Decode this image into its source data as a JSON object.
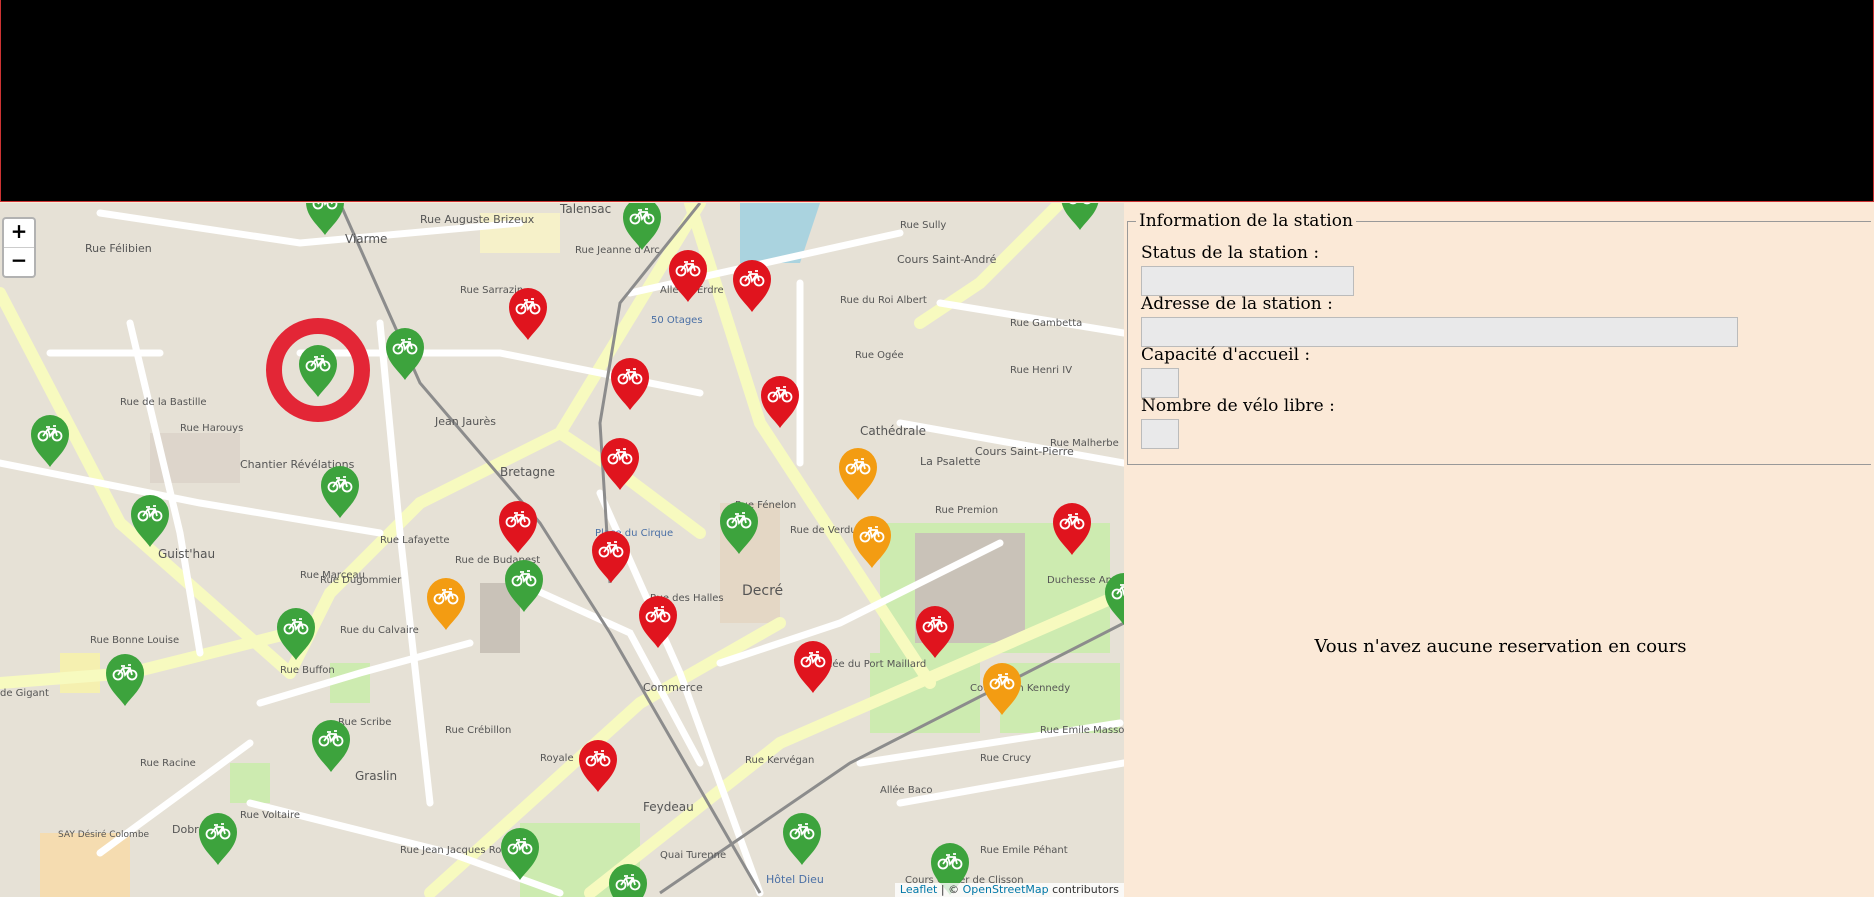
{
  "map": {
    "zoom_in": "+",
    "zoom_out": "−",
    "attribution_leaflet": "Leaflet",
    "attribution_sep": " | © ",
    "attribution_osm": "OpenStreetMap",
    "attribution_contrib": " contributors",
    "labels": [
      "Talensac",
      "Viarme",
      "Cours Saint-André",
      "Rue Auguste Brizeux",
      "Rue Félibien",
      "Jean Jaurès",
      "Bretagne",
      "Cathédrale",
      "Cours Saint-Pierre",
      "La Psalette",
      "Chantier Révélations",
      "Guist'hau",
      "Decré",
      "Commerce",
      "Graslin",
      "Feydeau",
      "Duchesse Anne-Château",
      "50 Otages",
      "Hôtel Dieu",
      "SAY Désiré Colombe",
      "Place du Cirque",
      "Rue de la Bastille",
      "Rue Harouys",
      "Rue Marceau",
      "Rue du Calvaire",
      "Rue Crébillon",
      "Rue Scribe",
      "Rue Racine",
      "Rue Voltaire",
      "Allée du Port Maillard",
      "Cours John Kennedy",
      "Rue Gambetta",
      "Rue Malherbe",
      "Rue Premion",
      "Rue Fénelon",
      "Rue des Halles",
      "Quai Turenne",
      "Rue Kervégan",
      "Allée Baco",
      "Rue Crucy",
      "Rue Emile Péhant",
      "de Gigant",
      "Rue Sully",
      "Rue Henri IV",
      "Rue du Roi Albert",
      "Rue Ogée",
      "Rue de Verdun",
      "Rue Jeanne d'Arc",
      "Rue Sarrazin",
      "Rue Dugommier",
      "Rue Lafayette",
      "Rue de Budapest",
      "Rue Jean Jacques Rousseau",
      "Rue Bonne Louise",
      "Rue Buffon",
      "Royale",
      "Dobrée",
      "Rue Emile Masson",
      "Cours Olivier de Clisson",
      "Allée d'Erdre"
    ],
    "colors": {
      "green": "#3da33d",
      "red": "#e0141e",
      "orange": "#f39c12",
      "highlight": "#e32636"
    },
    "markers": [
      {
        "status": "green"
      },
      {
        "status": "green"
      },
      {
        "status": "red"
      },
      {
        "status": "red"
      },
      {
        "status": "red"
      },
      {
        "status": "green"
      },
      {
        "status": "green"
      },
      {
        "status": "red"
      },
      {
        "status": "red"
      },
      {
        "status": "green"
      },
      {
        "status": "red"
      },
      {
        "status": "orange"
      },
      {
        "status": "green"
      },
      {
        "status": "green"
      },
      {
        "status": "red"
      },
      {
        "status": "red"
      },
      {
        "status": "green"
      },
      {
        "status": "orange"
      },
      {
        "status": "orange"
      },
      {
        "status": "red"
      },
      {
        "status": "green"
      },
      {
        "status": "green"
      },
      {
        "status": "red"
      },
      {
        "status": "green"
      },
      {
        "status": "red"
      },
      {
        "status": "red"
      },
      {
        "status": "orange"
      },
      {
        "status": "green"
      },
      {
        "status": "green"
      },
      {
        "status": "green"
      },
      {
        "status": "red"
      },
      {
        "status": "green"
      },
      {
        "status": "green"
      },
      {
        "status": "green"
      },
      {
        "status": "green"
      },
      {
        "status": "green"
      }
    ]
  },
  "panel": {
    "legend": "Information de la station",
    "status_label": "Status de la station :",
    "address_label": "Adresse de la station :",
    "capacity_label": "Capacité d'accueil :",
    "bikes_label": "Nombre de vélo libre :",
    "status_value": "",
    "address_value": "",
    "capacity_value": "",
    "bikes_value": "",
    "no_reservation": "Vous n'avez aucune reservation en cours"
  }
}
